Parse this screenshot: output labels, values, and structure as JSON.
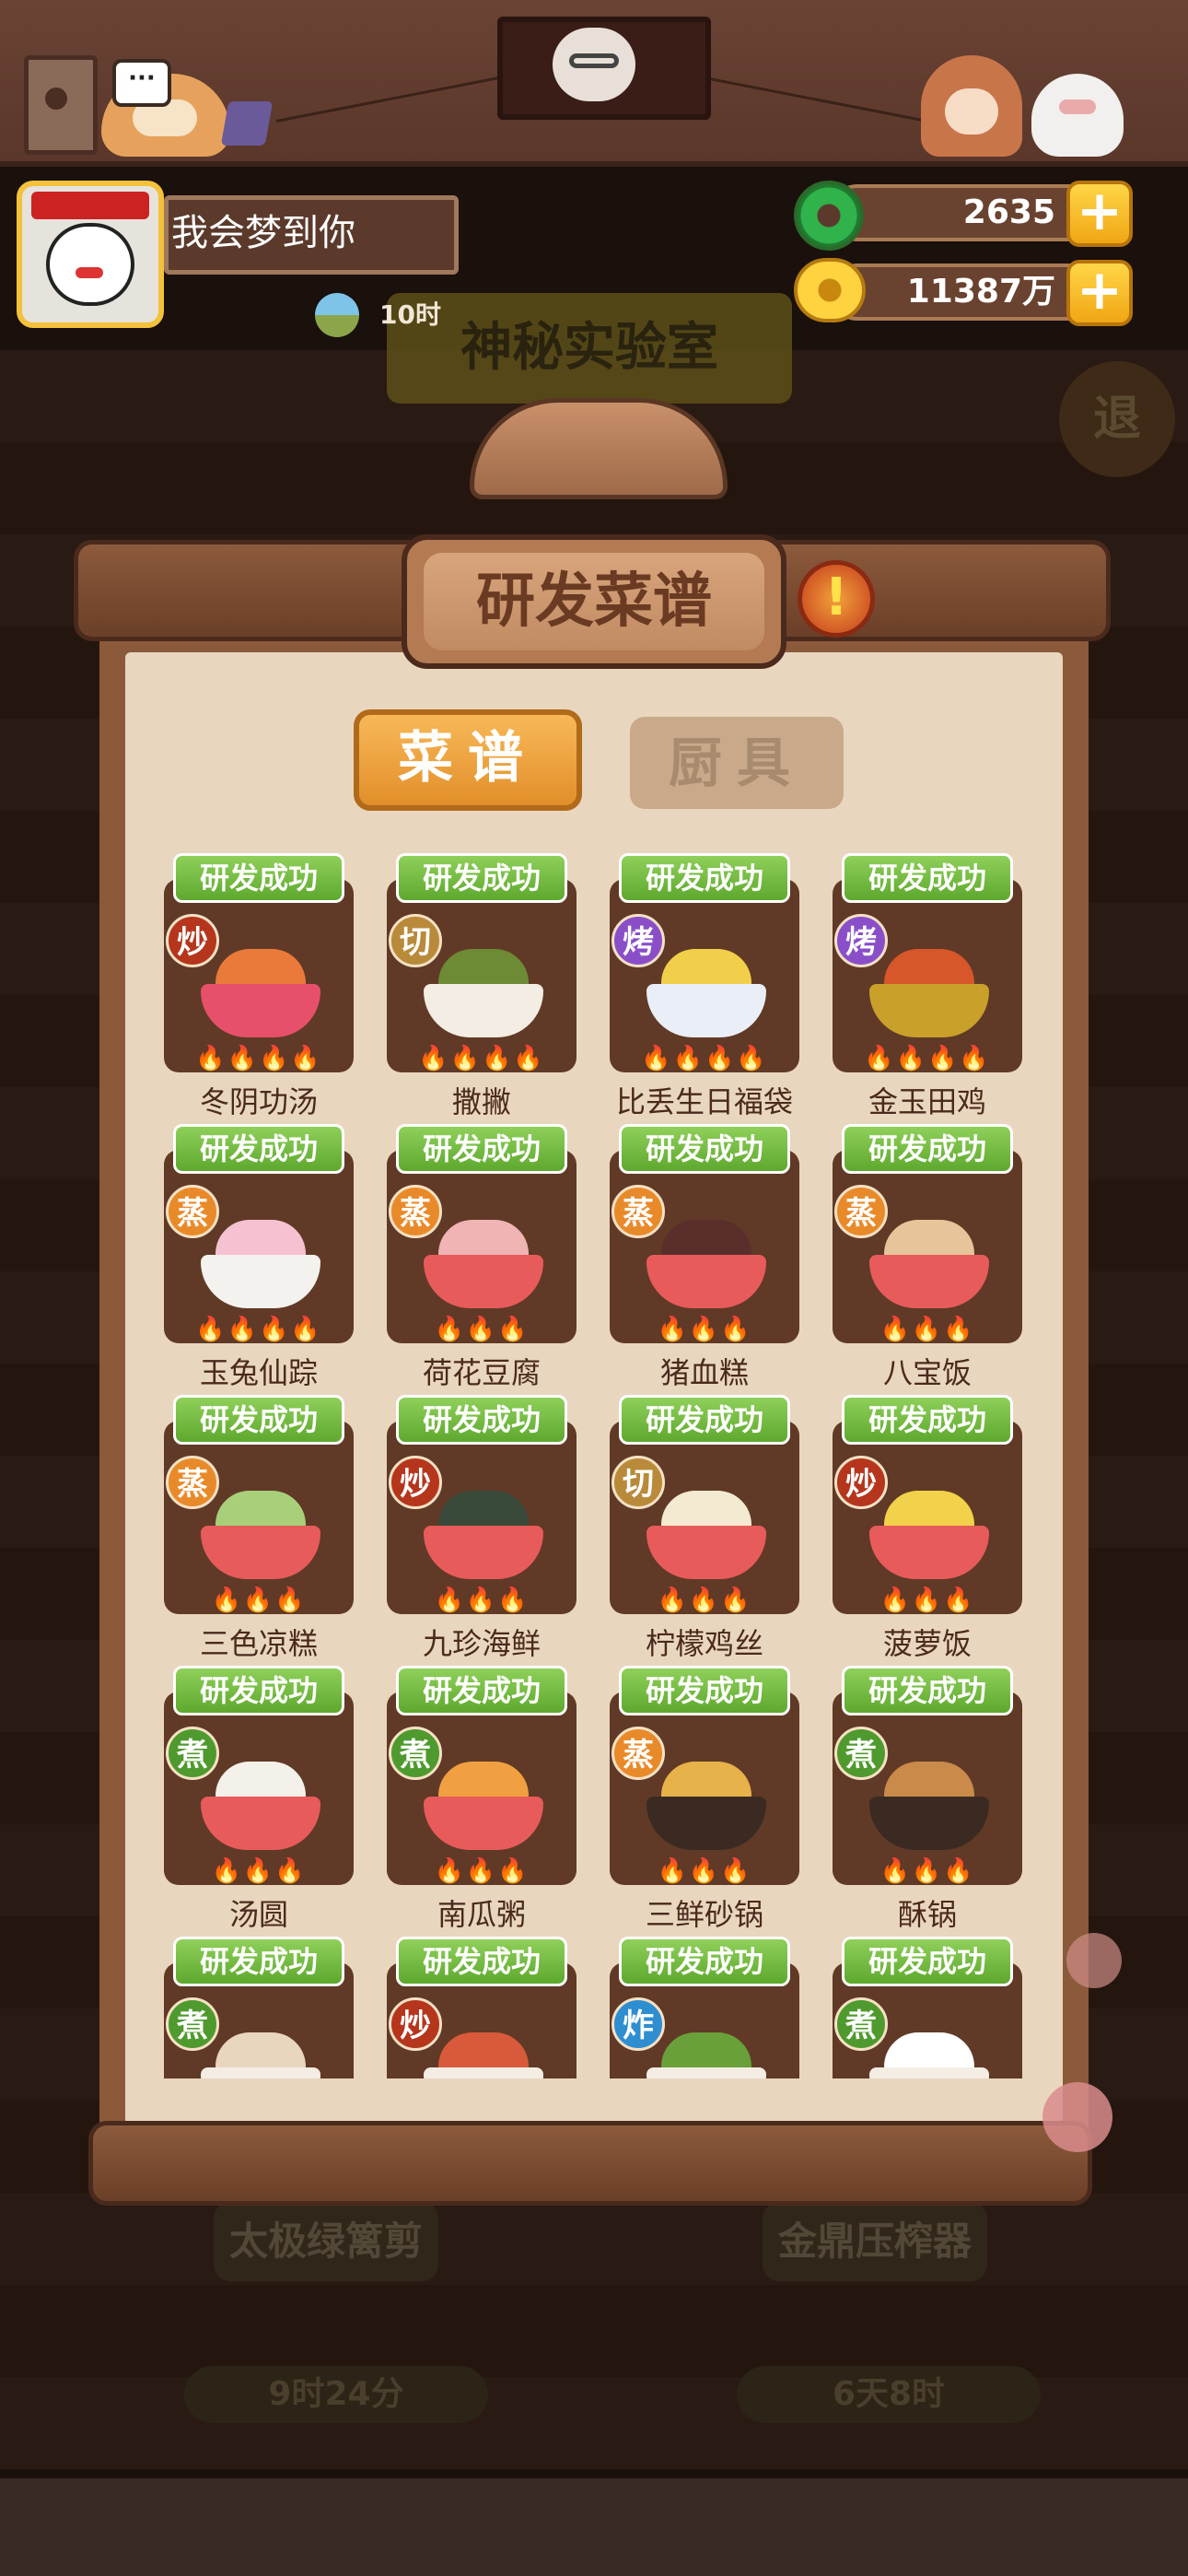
{
  "player": {
    "name": "我会梦到你",
    "time": "10时"
  },
  "currency": {
    "jade": "2635",
    "gold": "11387万"
  },
  "background": {
    "lab_sign": "神秘实验室",
    "back_button": "退",
    "station_left": "太极绿篱剪",
    "station_right": "金鼎压榨器",
    "timer_left": "9时24分",
    "timer_right": "6天8时"
  },
  "modal": {
    "title": "研发菜谱",
    "alert": "!",
    "tabs": {
      "recipes": "菜谱",
      "tools": "厨具"
    },
    "chat": "···"
  },
  "colors": {
    "stir_fry": "#b5361d",
    "cut": "#b98a3a",
    "bake": "#8a4fc8",
    "steam": "#e98a2a",
    "boil": "#4f9a2e",
    "deep_fry": "#2f8ed0",
    "badge_green": "#6cba37",
    "card_bg": "#603a26"
  },
  "recipes": [
    {
      "status": "研发成功",
      "method": "炒",
      "method_key": "stir_fry",
      "name": "冬阴功汤",
      "flames": "🔥🔥🔥🔥",
      "bowl": "#e7506a",
      "food": "#e97a3a"
    },
    {
      "status": "研发成功",
      "method": "切",
      "method_key": "cut",
      "name": "撒撇",
      "flames": "🔥🔥🔥🔥",
      "bowl": "#f4ede4",
      "food": "#6d8a34"
    },
    {
      "status": "研发成功",
      "method": "烤",
      "method_key": "bake",
      "name": "比丢生日福袋",
      "flames": "🔥🔥🔥🔥",
      "bowl": "#eaeef6",
      "food": "#f2cf4a"
    },
    {
      "status": "研发成功",
      "method": "烤",
      "method_key": "bake",
      "name": "金玉田鸡",
      "flames": "🔥🔥🔥🔥",
      "bowl": "#c9a02a",
      "food": "#d7562a"
    },
    {
      "status": "研发成功",
      "method": "蒸",
      "method_key": "steam",
      "name": "玉兔仙踪",
      "flames": "🔥🔥🔥🔥",
      "bowl": "#f4f2ee",
      "food": "#f6c2d2"
    },
    {
      "status": "研发成功",
      "method": "蒸",
      "method_key": "steam",
      "name": "荷花豆腐",
      "flames": "🔥🔥🔥",
      "bowl": "#e85b5b",
      "food": "#f0b4b4"
    },
    {
      "status": "研发成功",
      "method": "蒸",
      "method_key": "steam",
      "name": "猪血糕",
      "flames": "🔥🔥🔥",
      "bowl": "#e85b5b",
      "food": "#5a2e2a"
    },
    {
      "status": "研发成功",
      "method": "蒸",
      "method_key": "steam",
      "name": "八宝饭",
      "flames": "🔥🔥🔥",
      "bowl": "#e85b5b",
      "food": "#e6c59a"
    },
    {
      "status": "研发成功",
      "method": "蒸",
      "method_key": "steam",
      "name": "三色凉糕",
      "flames": "🔥🔥🔥",
      "bowl": "#e85b5b",
      "food": "#a8d07a"
    },
    {
      "status": "研发成功",
      "method": "炒",
      "method_key": "stir_fry",
      "name": "九珍海鲜",
      "flames": "🔥🔥🔥",
      "bowl": "#e85b5b",
      "food": "#3a4a3a"
    },
    {
      "status": "研发成功",
      "method": "切",
      "method_key": "cut",
      "name": "柠檬鸡丝",
      "flames": "🔥🔥🔥",
      "bowl": "#e85b5b",
      "food": "#f4ead2"
    },
    {
      "status": "研发成功",
      "method": "炒",
      "method_key": "stir_fry",
      "name": "菠萝饭",
      "flames": "🔥🔥🔥",
      "bowl": "#e85b5b",
      "food": "#f2d24a"
    },
    {
      "status": "研发成功",
      "method": "煮",
      "method_key": "boil",
      "name": "汤圆",
      "flames": "🔥🔥🔥",
      "bowl": "#e85b5b",
      "food": "#f4f0ea"
    },
    {
      "status": "研发成功",
      "method": "煮",
      "method_key": "boil",
      "name": "南瓜粥",
      "flames": "🔥🔥🔥",
      "bowl": "#e85b5b",
      "food": "#f0a040"
    },
    {
      "status": "研发成功",
      "method": "蒸",
      "method_key": "steam",
      "name": "三鲜砂锅",
      "flames": "🔥🔥🔥",
      "bowl": "#3a2a22",
      "food": "#e8b24a"
    },
    {
      "status": "研发成功",
      "method": "煮",
      "method_key": "boil",
      "name": "酥锅",
      "flames": "🔥🔥🔥",
      "bowl": "#3a2a22",
      "food": "#c98a4a"
    },
    {
      "status": "研发成功",
      "method": "煮",
      "method_key": "boil",
      "name": "",
      "flames": "",
      "bowl": "#f4ede4",
      "food": "#e9d6bf"
    },
    {
      "status": "研发成功",
      "method": "炒",
      "method_key": "stir_fry",
      "name": "",
      "flames": "",
      "bowl": "#f4ede4",
      "food": "#d95a3a"
    },
    {
      "status": "研发成功",
      "method": "炸",
      "method_key": "deep_fry",
      "name": "",
      "flames": "",
      "bowl": "#f4ede4",
      "food": "#6aa03a"
    },
    {
      "status": "研发成功",
      "method": "煮",
      "method_key": "boil",
      "name": "",
      "flames": "",
      "bowl": "#f4ede4",
      "food": "#ffffff"
    }
  ]
}
